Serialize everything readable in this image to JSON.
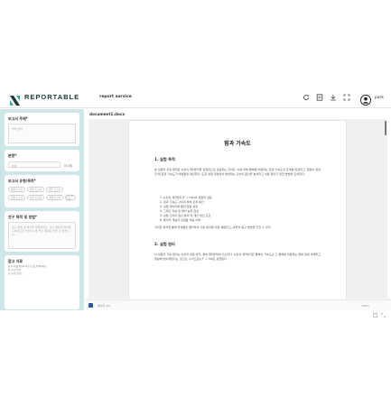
{
  "header": {
    "brand": "REPORTABLE",
    "service": "report service",
    "user": "park",
    "icons": [
      "refresh-icon",
      "document-icon",
      "download-icon",
      "expand-icon",
      "user-avatar-icon"
    ]
  },
  "sidebar": {
    "report_subject": {
      "label": "보고서 주제*",
      "placeholder": "주제 입력"
    },
    "length": {
      "label": "분량*",
      "placeholder": "분량",
      "unit": "자 (자)"
    },
    "report_type": {
      "label": "보고서 유형/목적*",
      "chips": [
        "실험 보고서",
        "결과 보고서",
        "업무 보고서",
        "현장 보고서",
        "사업 보고서",
        "주제 보고서",
        "논문 보고서"
      ]
    },
    "research": {
      "label": "연구 목적 및 방법*",
      "placeholder": "연구 방법 및 목적을 입력하세요. 연구 방법과 목적을 구체적으로 작성할수록 좋은 결과를 얻을 수 있습니다."
    },
    "references": {
      "label": "참고 자료",
      "items": [
        "참고자료를 첨부하거나 링크를 입력하세요",
        "참고자료 입력",
        "참고자료 업로드"
      ]
    }
  },
  "document": {
    "file_name": "document1.docx",
    "title": "힘과 가속도",
    "sections": [
      {
        "heading": "1. 실험 목적",
        "paragraph": "본 실험의 주된 목적은 뉴턴의 제2법칙을 실험적으로 검증하는 것이다. 이를 위해 물체에 작용하는 힘과 가속도의 관계를 측정하고, 질량이 일정할 때 힘과 가속도가 비례함을 확인한다. 또한 실험 과정에서 발생하는 오차의 원인을 분석하고 이를 줄이기 위한 방법을 모색한다.",
        "list": [
          "1. 뉴턴의 제2법칙 (F = ma)의 실험적 검증",
          "2. 힘과 가속도 사이의 비례 관계 확인",
          "3. 실험 데이터를 통한 질량 측정",
          "4. 그래프 작성 및 해석 능력 향상",
          "5. 실험 오차의 원인 분석 및 개선 방안 도출",
          "6. 물리적 개념의 실생활 적용 이해"
        ],
        "closing": "이러한 목적을 통해 학생들은 물리학의 기본 원리를 직접 체험하고, 과학적 탐구 방법을 익힐 수 있다."
      },
      {
        "heading": "2. 실험 원리",
        "paragraph": "이 실험의 기본 원리는 뉴턴의 운동 법칙, 특히 제2법칙에 기초한다. 뉴턴의 제2법칙은 물체의 가속도는 그 물체에 작용하는 알짜 힘에 비례하고 질량에 반비례한다는 것으로, 수식으로는 F = ma로 표현된다."
      }
    ]
  },
  "statusbar": {
    "page_info": "페이지 1/2",
    "zoom": "100%"
  },
  "colors": {
    "sidebar_bg": "#cfe6e8",
    "brand_dark": "#1e3a3a",
    "brand_teal": "#3aa99f",
    "word_blue": "#2b5797"
  }
}
